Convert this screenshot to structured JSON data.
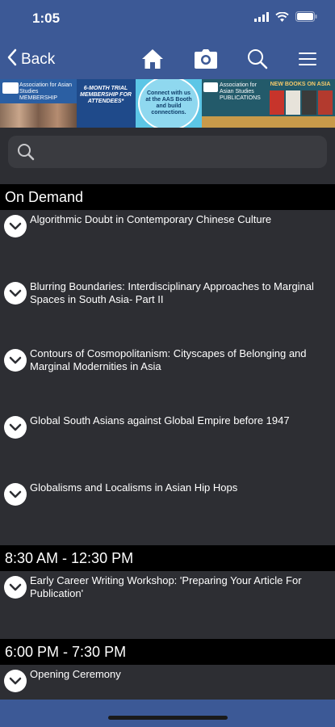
{
  "status": {
    "time": "1:05"
  },
  "nav": {
    "back_label": "Back"
  },
  "banner": {
    "left_text": "Association for Asian Studies MEMBERSHIP",
    "trial_text": "6-MONTH TRIAL MEMBERSHIP FOR ATTENDEES*",
    "connect_text": "Connect with us at the AAS Booth and build connections.",
    "pub_text": "Association for Asian Studies PUBLICATIONS",
    "books_text": "NEW BOOKS ON ASIA"
  },
  "search": {
    "placeholder": ""
  },
  "sections": [
    {
      "header": "On Demand",
      "items": [
        "Algorithmic Doubt in Contemporary Chinese Culture",
        "Blurring Boundaries: Interdisciplinary Approaches to Marginal Spaces in South Asia- Part II",
        "Contours of Cosmopolitanism: Cityscapes of Belonging and Marginal Modernities in Asia",
        "Global South Asians against Global Empire before 1947",
        "Globalisms and Localisms in Asian Hip Hops"
      ]
    },
    {
      "header": "8:30 AM - 12:30 PM",
      "items": [
        "Early Career Writing Workshop: 'Preparing Your Article For Publication'"
      ]
    },
    {
      "header": "6:00 PM - 7:30 PM",
      "items": [
        "Opening Ceremony"
      ]
    }
  ]
}
